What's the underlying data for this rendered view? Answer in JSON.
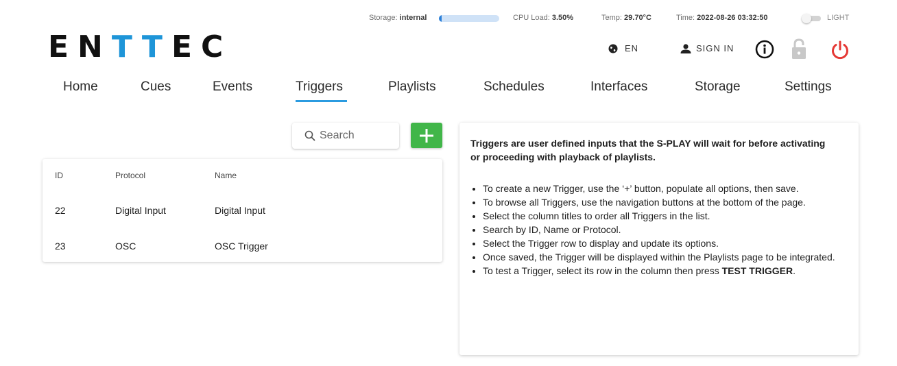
{
  "status": {
    "storage_label": "Storage:",
    "storage_value": "internal",
    "storage_fill": 0.04,
    "cpu_label": "CPU Load:",
    "cpu_value": "3.50%",
    "temp_label": "Temp:",
    "temp_value": "29.70°C",
    "time_label": "Time:",
    "time_value": "2022-08-26 03:32:50",
    "theme_label": "LIGHT"
  },
  "logo": {
    "part1": "EN",
    "part2": "TT",
    "part3": "EC"
  },
  "header": {
    "language_label": "EN",
    "language_icon": "globe-icon",
    "signin_label": "SIGN IN",
    "signin_icon": "user-icon",
    "info_icon": "info-icon",
    "lock_icon": "lock-icon",
    "power_icon": "power-icon",
    "power_color": "#e53935"
  },
  "nav": {
    "items": [
      "Home",
      "Cues",
      "Events",
      "Triggers",
      "Playlists",
      "Schedules",
      "Interfaces",
      "Storage",
      "Settings"
    ],
    "active": "Triggers",
    "accent": "#2b9be0"
  },
  "search": {
    "placeholder": "Search",
    "icon": "search-icon"
  },
  "add_button": {
    "icon": "plus-icon",
    "color": "#41b649"
  },
  "table": {
    "columns": [
      "ID",
      "Protocol",
      "Name"
    ],
    "rows": [
      [
        "22",
        "Digital Input",
        "Digital Input"
      ],
      [
        "23",
        "OSC",
        "OSC Trigger"
      ]
    ]
  },
  "info": {
    "title": "Triggers are user defined inputs that the S-PLAY will wait for before activating or proceeding with playback of playlists.",
    "items": [
      "To create a new Trigger, use the ‘+’ button, populate all options, then save.",
      "To browse all Triggers, use the navigation buttons at the bottom of the page.",
      "Select the column titles to order all Triggers in the list.",
      "Search by ID, Name or Protocol.",
      "Select the Trigger row to display and update its options.",
      "Once saved, the Trigger will be displayed within the Playlists page to be integrated."
    ],
    "last_item_prefix": "To test a Trigger, select its row in the column then press",
    "last_item_bold": "TEST TRIGGER",
    "last_item_suffix": "."
  }
}
